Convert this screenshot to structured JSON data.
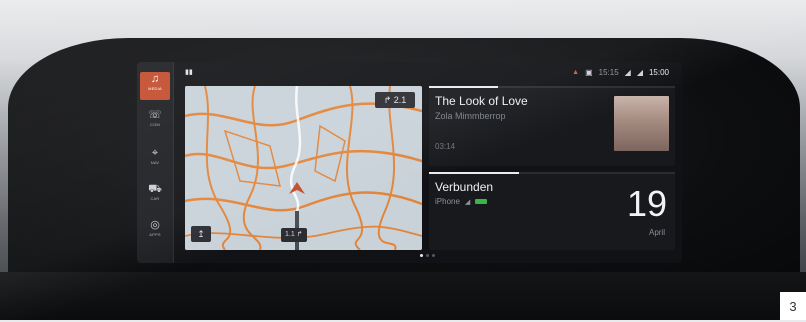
{
  "sidebar": {
    "items": [
      {
        "icon": "music-note-icon",
        "glyph": "♫",
        "label": "MEDIA",
        "active": true
      },
      {
        "icon": "phone-icon",
        "glyph": "☏",
        "label": "COM",
        "active": false
      },
      {
        "icon": "navigation-icon",
        "glyph": "⌖",
        "label": "NAV",
        "active": false
      },
      {
        "icon": "car-icon",
        "glyph": "⛟",
        "label": "CAR",
        "active": false
      },
      {
        "icon": "apps-icon",
        "glyph": "◎",
        "label": "APPS",
        "active": false
      }
    ]
  },
  "statusbar": {
    "left_indicator": "▮▮",
    "warning_glyph": "▲",
    "time_alt": "15:15",
    "time_main": "15:00"
  },
  "map": {
    "turn_glyph": "↱",
    "turn_distance": "2.1",
    "route_chip": "1.1 ↱",
    "menu_glyph": "↥"
  },
  "media": {
    "title": "The Look of Love",
    "artist": "Zola Mimmberrop",
    "elapsed": "03:14",
    "progress": 0.28
  },
  "connection": {
    "title": "Verbunden",
    "device": "iPhone",
    "day": "19",
    "month": "April"
  },
  "page": {
    "number": "3"
  },
  "colors": {
    "accent": "#c24b2c",
    "route": "#e1853a",
    "battery": "#39b54a"
  }
}
